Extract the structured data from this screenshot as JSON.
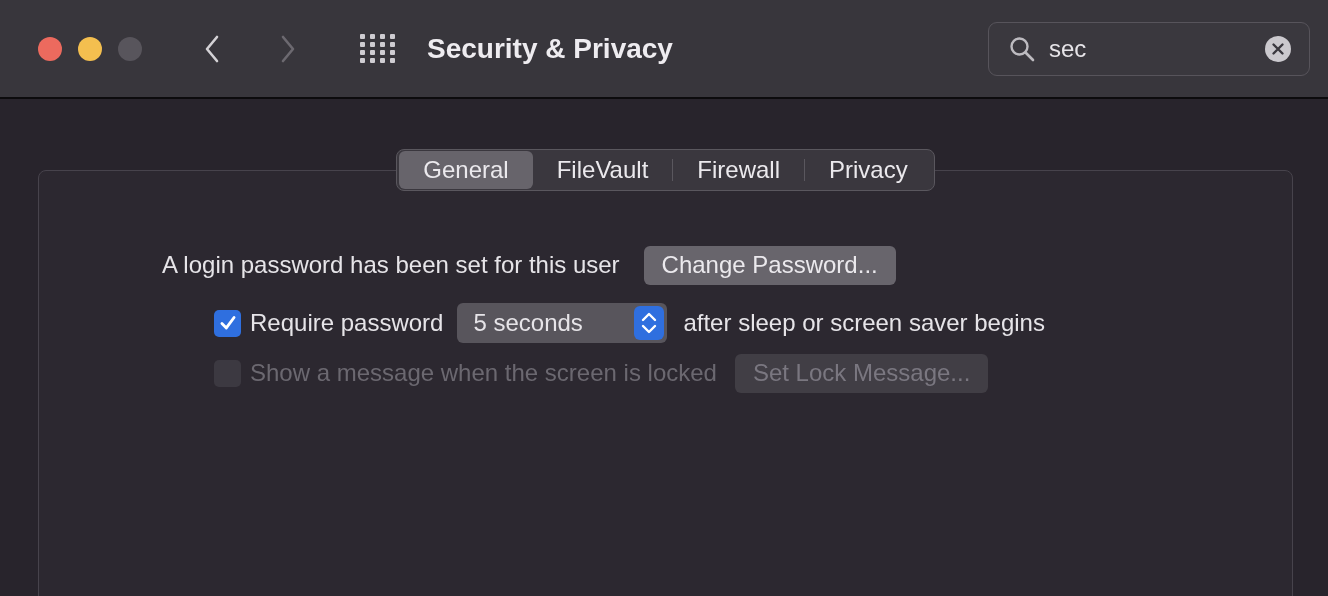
{
  "window": {
    "title": "Security & Privacy",
    "traffic_lights": [
      {
        "kind": "close",
        "disabled": false
      },
      {
        "kind": "minimize",
        "disabled": false
      },
      {
        "kind": "zoom",
        "disabled": true
      }
    ],
    "nav": [
      {
        "kind": "back",
        "disabled": false
      },
      {
        "kind": "forward",
        "disabled": true
      }
    ]
  },
  "search": {
    "value": "sec"
  },
  "tabs": [
    {
      "label": "General",
      "selected": true
    },
    {
      "label": "FileVault",
      "selected": false
    },
    {
      "label": "Firewall",
      "selected": false
    },
    {
      "label": "Privacy",
      "selected": false
    }
  ],
  "login": {
    "text": "A login password has been set for this user",
    "button": "Change Password..."
  },
  "require_password": {
    "label": "Require password",
    "checked": true,
    "disabled": false,
    "popup": "5 seconds",
    "suffix": "after sleep or screen saver begins"
  },
  "lock_message": {
    "label": "Show a message when the screen is locked",
    "checked": false,
    "disabled": true,
    "button": "Set Lock Message..."
  }
}
